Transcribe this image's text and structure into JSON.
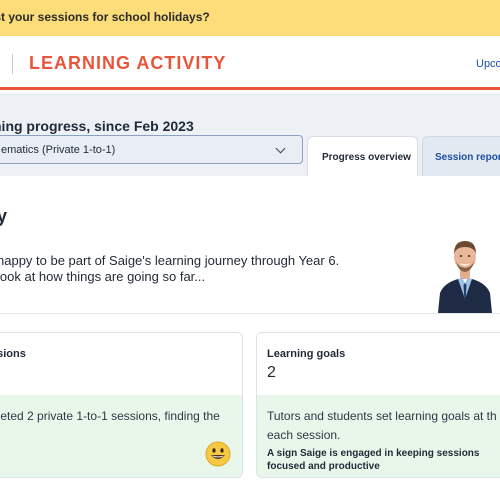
{
  "banner": {
    "text": "ust your sessions for school holidays?"
  },
  "header": {
    "title": "LEARNING ACTIVITY",
    "link": "Upco"
  },
  "toolbar": {
    "heading": "ning progress, since Feb 2023",
    "select_value": "ematics (Private 1-to-1)"
  },
  "tabs": [
    {
      "label": "Progress overview",
      "active": true
    },
    {
      "label": "Session reports",
      "active": false
    }
  ],
  "summary": {
    "title": "ry",
    "intro_line_1": "happy to be part of Saige's learning journey through Year 6.",
    "intro_line_2": "look at how things are going so far..."
  },
  "cards": {
    "sessions": {
      "label": "ssions",
      "text": "pleted 2 private 1-to-1 sessions, finding the"
    },
    "goals": {
      "label": "Learning goals",
      "value": "2",
      "text_1": "Tutors and students set learning goals at th",
      "text_2": "each session.",
      "note_1": "A sign Saige is engaged in keeping sessions",
      "note_2": "focused and productive"
    }
  },
  "icons": {
    "emoji": "smiling-face-icon",
    "chevron": "chevron-down-icon"
  },
  "colors": {
    "accent": "#e8553a",
    "banner": "#fddc7a",
    "link": "#1e4fa3",
    "success_bg": "#e9f7ea"
  }
}
